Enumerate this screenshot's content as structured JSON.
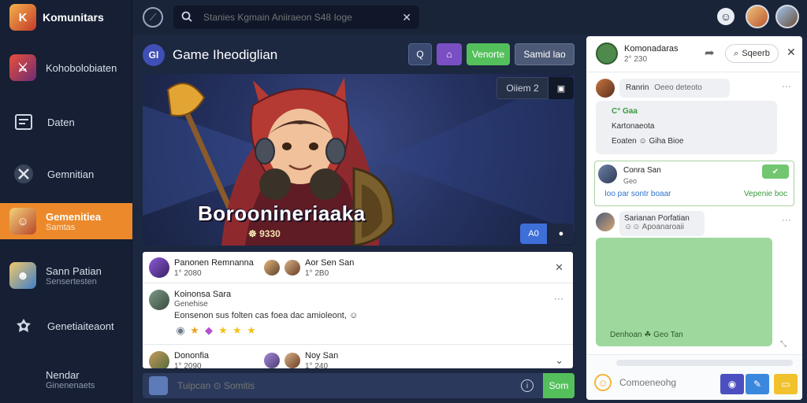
{
  "app": {
    "brand_name": "Komunitars",
    "brand_avatar": "K"
  },
  "sidebar": {
    "items": [
      {
        "label": "Kohobolobiaten",
        "sub": "",
        "icon": "hero-avatar-icon",
        "active": false
      },
      {
        "label": "Daten",
        "sub": "",
        "icon": "document-icon",
        "active": false
      },
      {
        "label": "Gemnitian",
        "sub": "",
        "icon": "crossed-swords-icon",
        "active": false
      },
      {
        "label": "Gemenitiea",
        "sub": "Samtas",
        "icon": "hero-avatar-icon",
        "active": true
      },
      {
        "label": "Sann Patian",
        "sub": "Sensertesten",
        "icon": "hero-avatar-icon",
        "active": false
      },
      {
        "label": "Genetiaiteaont",
        "sub": "",
        "icon": "gear-icon",
        "active": false
      },
      {
        "label": "Nendar",
        "sub": "Ginenenaets",
        "icon": "",
        "active": false
      }
    ]
  },
  "topbar": {
    "search_placeholder": "Stanies Kgmain Aniiraeon S48 Ioge",
    "search_icon": "search-icon",
    "clear_icon": "close-icon",
    "emoji_icon": "smiley-icon"
  },
  "game": {
    "title": "Game Iheodiglian",
    "logo_text": "Gl",
    "actions": {
      "icon1": "Q",
      "icon2": "⌂",
      "primary_label": "Venorte",
      "secondary_label": "Samid lao"
    },
    "banner": {
      "title": "Boroonineriaaka",
      "count": "☸ 9330",
      "pill_label": "Oiiem 2",
      "pill_icon": "▣",
      "action_a": "A0",
      "action_b": "●"
    }
  },
  "feed": {
    "posts": [
      {
        "name": "Panonen Remnanna",
        "meta": "1° 2080",
        "mini": [
          {
            "name": "Aor Sen San",
            "meta": "1° 2B0"
          }
        ]
      },
      {
        "name": "Koinonsa Sara",
        "meta": "Genehise",
        "text": "Eonsenon sus folten cas foea dac amioleont, ☺",
        "reactions": [
          "◉",
          "★",
          "◆",
          "★",
          "★",
          "★"
        ]
      },
      {
        "name": "Dononfia",
        "meta": "1° 2090",
        "mini": [
          {
            "name": "Noy San",
            "meta": "1° 240"
          }
        ]
      }
    ]
  },
  "composer": {
    "placeholder": "Tuipcan ⊙ Somitis",
    "send_label": "Som",
    "info_icon": "info-icon"
  },
  "chat": {
    "title": "Komonadaras",
    "subtitle": "2° 230",
    "search_label": "Sqeerb",
    "messages": [
      {
        "name": "Ranrin",
        "text": "Oeeo deteoto",
        "detail_1": "C° Gaa",
        "detail_2": "Kartonaeota",
        "detail_3": "Eoaten ☺ Giha Bioe"
      },
      {
        "name": "Conra San",
        "meta": "Geo",
        "link": "Ioo par sontr boaar",
        "link_right": "Vepenie boc",
        "badge": "✔"
      },
      {
        "name": "Sarianan Porfatian",
        "meta": "☺☺ Apoanaroaii",
        "green_caption": "Denhoan ☘ Geo Tan"
      }
    ],
    "footer": {
      "input_placeholder": "Comoeneohg",
      "progress_pct": 100
    }
  },
  "colors": {
    "sidebar_bg": "#161f33",
    "active_nav": "#ec8a2b",
    "accent_green": "#54c05b",
    "accent_purple": "#7a4fc4",
    "accent_blue": "#3e6ed8"
  }
}
